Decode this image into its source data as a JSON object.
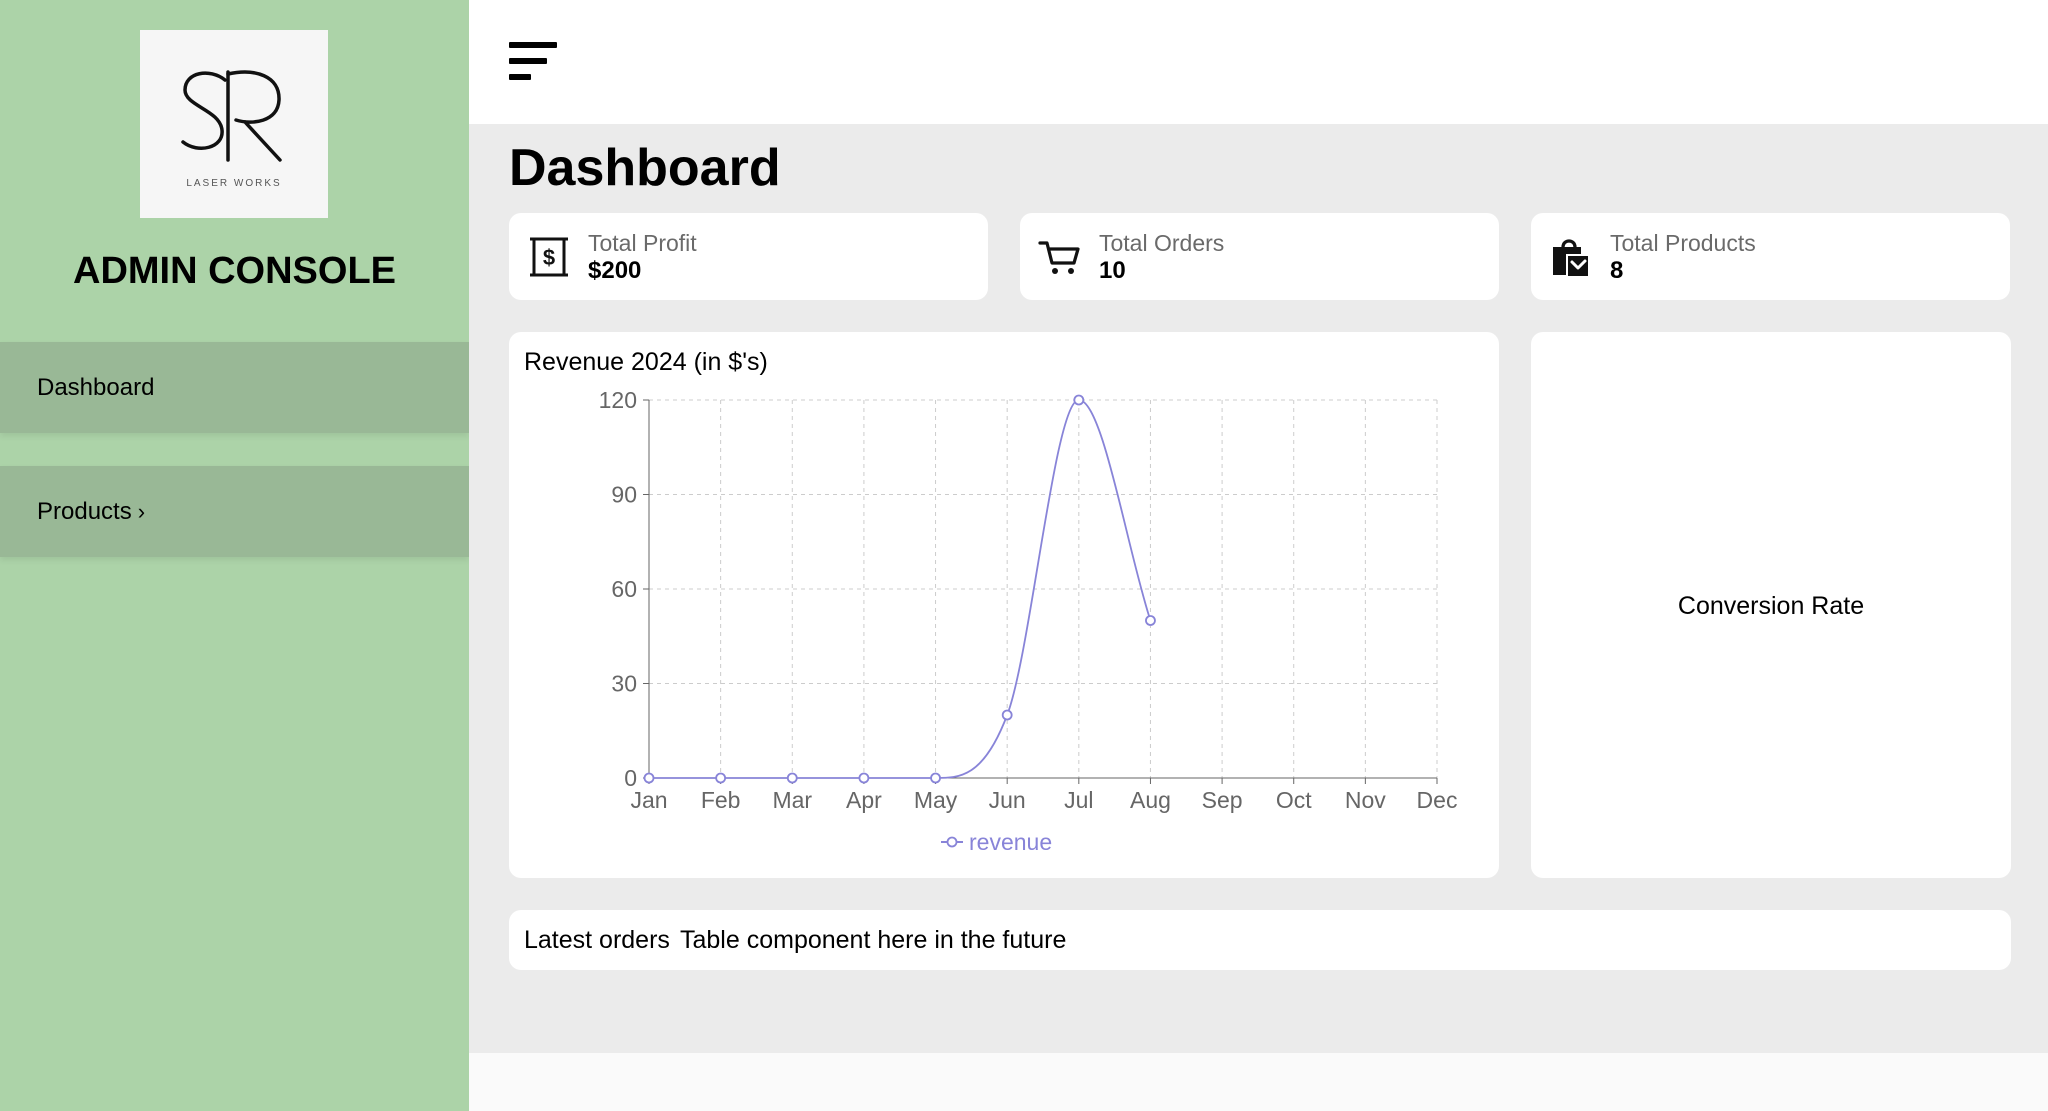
{
  "brand": {
    "logo_subtitle": "LASER WORKS",
    "title": "ADMIN CONSOLE"
  },
  "sidebar": {
    "items": [
      {
        "label": "Dashboard",
        "active": true
      },
      {
        "label": "Products",
        "chevron": "›"
      }
    ]
  },
  "page": {
    "title": "Dashboard"
  },
  "stats": [
    {
      "label": "Total Profit",
      "value": "$200",
      "icon": "dollar-bill-icon"
    },
    {
      "label": "Total Orders",
      "value": "10",
      "icon": "cart-icon"
    },
    {
      "label": "Total Products",
      "value": "8",
      "icon": "shopping-bag-icon"
    }
  ],
  "chart_data": {
    "type": "line",
    "title": "Revenue 2024 (in $'s)",
    "categories": [
      "Jan",
      "Feb",
      "Mar",
      "Apr",
      "May",
      "Jun",
      "Jul",
      "Aug",
      "Sep",
      "Oct",
      "Nov",
      "Dec"
    ],
    "series": [
      {
        "name": "revenue",
        "values": [
          0,
          0,
          0,
          0,
          0,
          20,
          120,
          50,
          null,
          null,
          null,
          null
        ],
        "color": "#8884d8"
      }
    ],
    "y_ticks": [
      0,
      30,
      60,
      90,
      120
    ],
    "ylim": [
      0,
      120
    ],
    "grid": true,
    "legend_position": "bottom-center"
  },
  "conversion": {
    "label": "Conversion Rate"
  },
  "orders": {
    "title": "Latest orders",
    "note": "Table component here in the future"
  },
  "colors": {
    "sidebar": "#acd3a8",
    "nav_item": "#99b896",
    "main_bg": "#ebebeb",
    "series": "#8884d8"
  }
}
